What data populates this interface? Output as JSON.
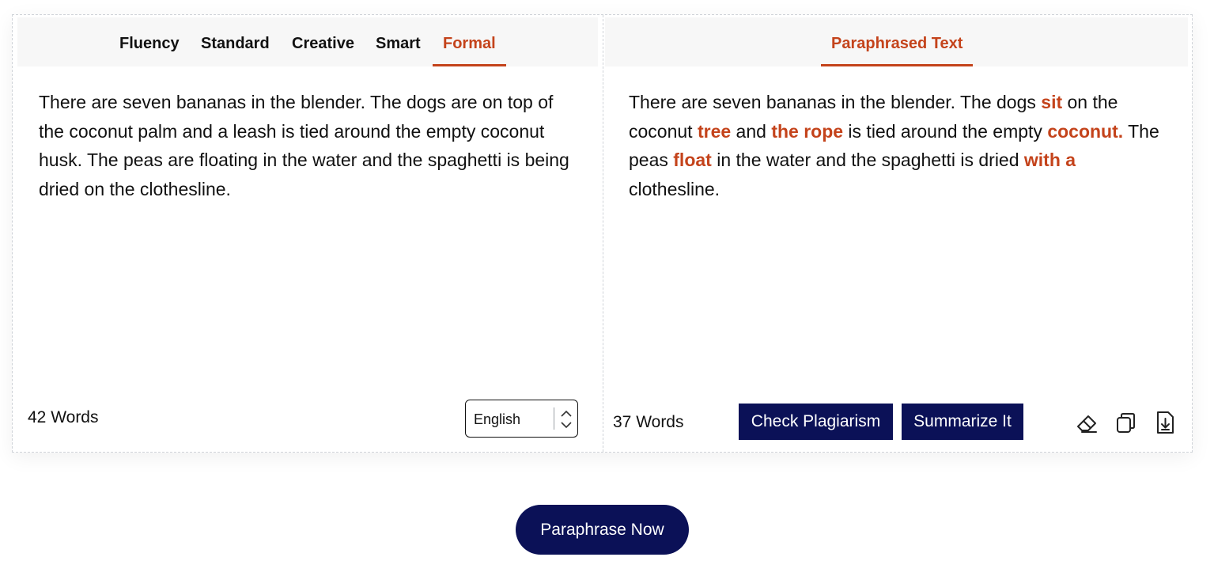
{
  "input_panel": {
    "modes": [
      "Fluency",
      "Standard",
      "Creative",
      "Smart",
      "Formal"
    ],
    "active_mode": "Formal",
    "text": "There are seven bananas in the blender. The dogs are on top of the coconut palm and a leash is tied around the empty coconut husk. The peas are floating in the water and the spaghetti is being dried on the clothesline.",
    "word_count": "42 Words",
    "language": "English"
  },
  "output_panel": {
    "tab_label": "Paraphrased Text",
    "segments": [
      {
        "text": "There are seven bananas in the blender. The dogs ",
        "changed": false
      },
      {
        "text": "sit",
        "changed": true
      },
      {
        "text": " on the coconut ",
        "changed": false
      },
      {
        "text": "tree",
        "changed": true
      },
      {
        "text": " and ",
        "changed": false
      },
      {
        "text": "the rope",
        "changed": true
      },
      {
        "text": " is tied around the empty ",
        "changed": false
      },
      {
        "text": "coconut.",
        "changed": true
      },
      {
        "text": " The peas ",
        "changed": false
      },
      {
        "text": "float",
        "changed": true
      },
      {
        "text": " in the water and the spaghetti is dried ",
        "changed": false
      },
      {
        "text": "with a",
        "changed": true
      },
      {
        "text": " clothesline.",
        "changed": false
      }
    ],
    "word_count": "37 Words",
    "check_plagiarism_label": "Check Plagiarism",
    "summarize_label": "Summarize It",
    "icons": [
      "eraser-icon",
      "copy-icon",
      "download-icon"
    ]
  },
  "paraphrase_button_label": "Paraphrase Now",
  "colors": {
    "accent": "#c4431b",
    "navy": "#0b1157"
  }
}
